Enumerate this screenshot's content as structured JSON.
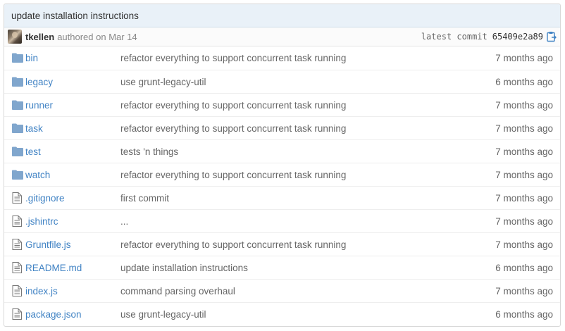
{
  "commit": {
    "title": "update installation instructions",
    "author": "tkellen",
    "authored_text": "authored on Mar 14",
    "latest_label": "latest commit",
    "sha": "65409e2a89"
  },
  "icons": {
    "folder": "folder-icon",
    "file": "file-icon",
    "clipboard": "clipboard-icon"
  },
  "colors": {
    "link": "#4183c4",
    "folder": "#80a6cd",
    "header_bg": "#e9f1f8"
  },
  "files": [
    {
      "type": "dir",
      "name": "bin",
      "message": "refactor everything to support concurrent task running",
      "age": "7 months ago"
    },
    {
      "type": "dir",
      "name": "legacy",
      "message": "use grunt-legacy-util",
      "age": "6 months ago"
    },
    {
      "type": "dir",
      "name": "runner",
      "message": "refactor everything to support concurrent task running",
      "age": "7 months ago"
    },
    {
      "type": "dir",
      "name": "task",
      "message": "refactor everything to support concurrent task running",
      "age": "7 months ago"
    },
    {
      "type": "dir",
      "name": "test",
      "message": "tests 'n things",
      "age": "7 months ago"
    },
    {
      "type": "dir",
      "name": "watch",
      "message": "refactor everything to support concurrent task running",
      "age": "7 months ago"
    },
    {
      "type": "file",
      "name": ".gitignore",
      "message": "first commit",
      "age": "7 months ago"
    },
    {
      "type": "file",
      "name": ".jshintrc",
      "message": "...",
      "age": "7 months ago"
    },
    {
      "type": "file",
      "name": "Gruntfile.js",
      "message": "refactor everything to support concurrent task running",
      "age": "7 months ago"
    },
    {
      "type": "file",
      "name": "README.md",
      "message": "update installation instructions",
      "age": "6 months ago"
    },
    {
      "type": "file",
      "name": "index.js",
      "message": "command parsing overhaul",
      "age": "7 months ago"
    },
    {
      "type": "file",
      "name": "package.json",
      "message": "use grunt-legacy-util",
      "age": "6 months ago"
    }
  ]
}
